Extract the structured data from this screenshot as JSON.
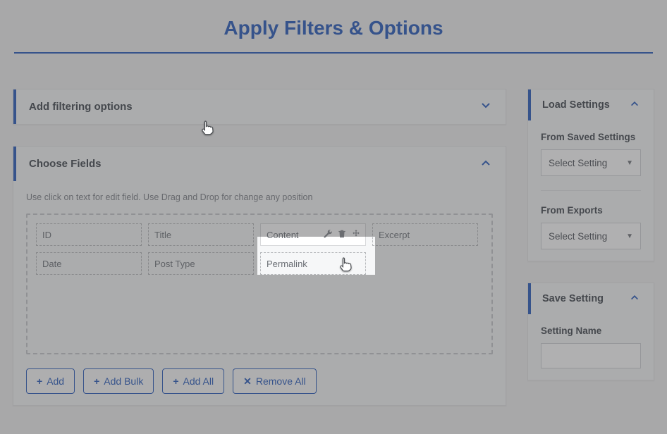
{
  "page_title": "Apply Filters & Options",
  "filterPanel": {
    "title": "Add filtering options"
  },
  "fieldsPanel": {
    "title": "Choose Fields",
    "hint": "Use click on text for edit field. Use Drag and Drop for change any position",
    "fields": [
      {
        "label": "ID"
      },
      {
        "label": "Title"
      },
      {
        "label": "Content",
        "highlighted": true
      },
      {
        "label": "Excerpt"
      },
      {
        "label": "Date"
      },
      {
        "label": "Post Type"
      },
      {
        "label": "Permalink"
      }
    ],
    "buttons": {
      "add": "Add",
      "add_bulk": "Add Bulk",
      "add_all": "Add All",
      "remove_all": "Remove All"
    }
  },
  "loadSettings": {
    "title": "Load Settings",
    "saved_heading": "From Saved Settings",
    "exports_heading": "From Exports",
    "select_placeholder": "Select Setting"
  },
  "saveSetting": {
    "title": "Save Setting",
    "name_label": "Setting Name"
  }
}
